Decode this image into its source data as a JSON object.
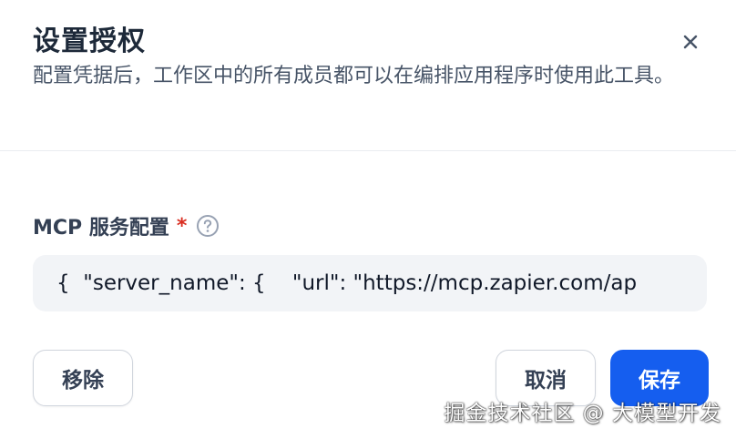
{
  "dialog": {
    "title": "设置授权",
    "description": "配置凭据后，工作区中的所有成员都可以在编排应用程序时使用此工具。",
    "close_icon": "close-icon"
  },
  "field": {
    "label": "MCP 服务配置",
    "required_mark": "*",
    "help_icon": "question-circle-icon",
    "value": "{  \"server_name\": {    \"url\": \"https://mcp.zapier.com/ap"
  },
  "actions": {
    "remove_label": "移除",
    "cancel_label": "取消",
    "save_label": "保存"
  },
  "watermark": "掘金技术社区 @ 大模型开发",
  "colors": {
    "primary": "#155eef",
    "required": "#d92d20",
    "input_bg": "#f2f4f7",
    "border": "#d0d5dd"
  }
}
